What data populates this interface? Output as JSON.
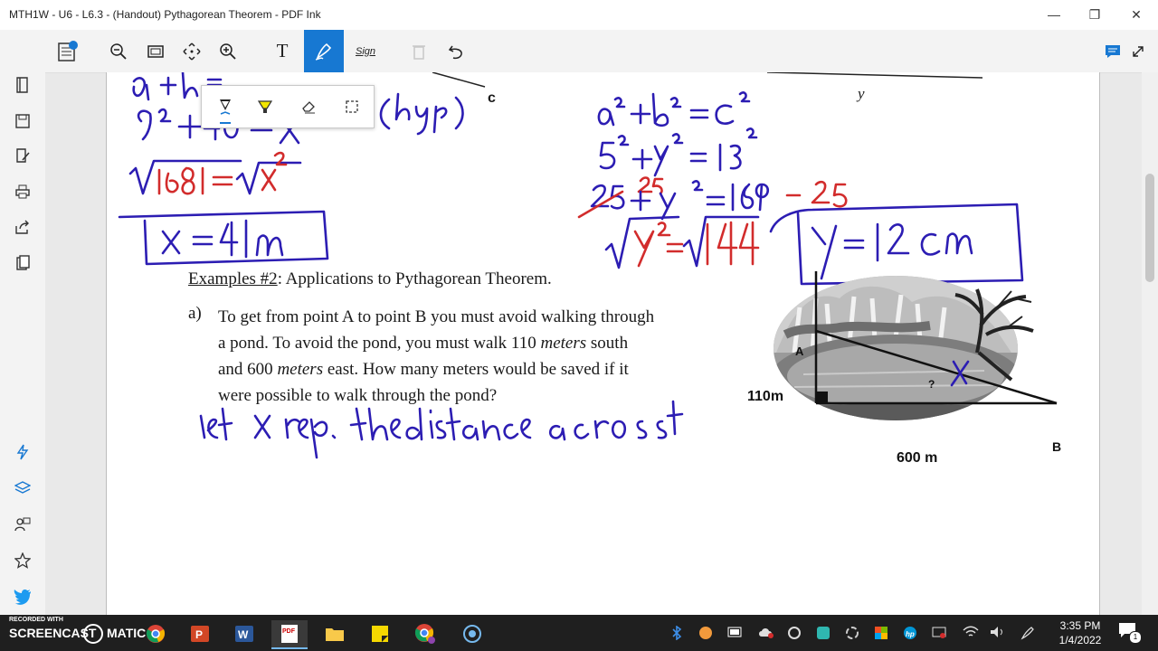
{
  "window": {
    "title": "MTH1W - U6 - L6.3 - (Handout) Pythagorean Theorem - PDF Ink"
  },
  "toolbar": {
    "sign_label": "Sign",
    "text_tool_label": "T"
  },
  "document": {
    "top_label_c": "c",
    "top_label_y": "y",
    "examples_heading": "Examples #2",
    "examples_heading_rest": ": Applications to Pythagorean Theorem.",
    "problem_letter": "a)",
    "problem_line1": "To get from point A to point B you must avoid walking through",
    "problem_line2_pre": "a pond.  To avoid the pond, you must walk 110 ",
    "problem_line2_em": "meters",
    "problem_line2_post": " south",
    "problem_line3_pre": "and 600 ",
    "problem_line3_em": "meters",
    "problem_line3_post": " east.  How many meters would be saved if it",
    "problem_line4": "were possible to walk through the pond?",
    "fig_label_a": "A",
    "fig_label_b": "B",
    "fig_label_110": "110m",
    "fig_label_600": "600 m",
    "fig_label_q": "?",
    "hw_hyp": "(hyp)",
    "hw_eq1": "a² + b² = c²",
    "hw_eq2": "5² + y² = 13²",
    "hw_result": "y = 12 cm",
    "hw_note": "let x rep. the distance across t"
  },
  "watermark": {
    "line1": "RECORDED WITH",
    "line2": "SCREENCAST",
    "line3": "MATIC"
  },
  "taskbar": {
    "time": "3:35 PM",
    "date": "1/4/2022",
    "notif_count": "1"
  },
  "colors": {
    "accent": "#1778d2",
    "ink_blue": "#2c1db3",
    "ink_red": "#d22c2c",
    "taskbar": "#1f1f1f"
  }
}
